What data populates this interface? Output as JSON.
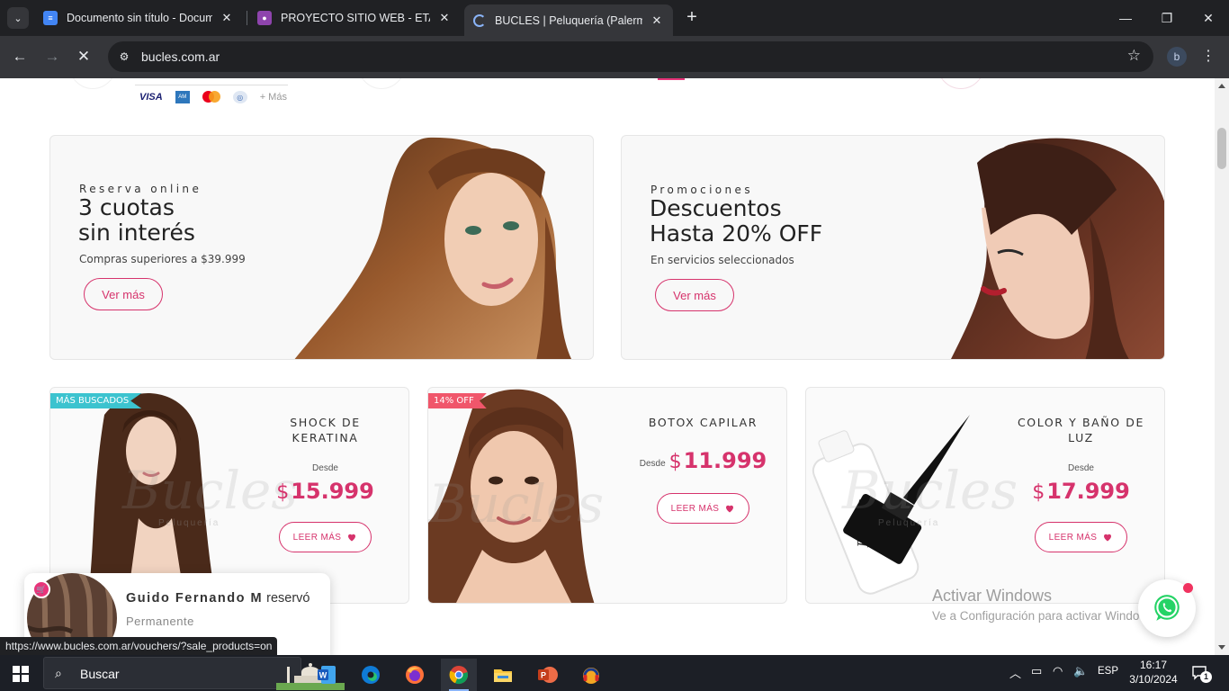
{
  "browser": {
    "tabs": [
      {
        "title": "Documento sin título - Documentos de Google",
        "close": "✕"
      },
      {
        "title": "PROYECTO SITIO WEB - ETAPAS",
        "close": "✕"
      },
      {
        "title": "BUCLES | Peluquería (Palermo Soho)",
        "close": "✕"
      }
    ],
    "new_tab": "+",
    "url": "bucles.com.ar",
    "window_controls": {
      "minimize": "—",
      "maximize": "❐",
      "close": "✕"
    },
    "profile_initial": "b"
  },
  "payments": {
    "visa": "VISA",
    "more": "+ Más"
  },
  "promos": [
    {
      "kicker": "Reserva online",
      "heading_line1": "3 cuotas",
      "heading_line2": "sin interés",
      "sub": "Compras superiores a $39.999",
      "cta": "Ver más"
    },
    {
      "kicker": "Promociones",
      "heading_line1": "Descuentos",
      "heading_line2": "Hasta 20% OFF",
      "sub": "En servicios seleccionados",
      "cta": "Ver más"
    }
  ],
  "services": [
    {
      "ribbon": "MÁS BUSCADOS",
      "name": "SHOCK DE KERATINA",
      "desde": "Desde",
      "currency": "$",
      "price": "15.999",
      "cta": "LEER MÁS"
    },
    {
      "ribbon": "14% OFF",
      "name": "BOTOX CAPILAR",
      "desde": "Desde",
      "currency": "$",
      "price": "11.999",
      "cta": "LEER MÁS"
    },
    {
      "ribbon": "",
      "name": "COLOR Y BAÑO DE LUZ",
      "desde": "Desde",
      "currency": "$",
      "price": "17.999",
      "cta": "LEER MÁS"
    }
  ],
  "watermark": {
    "word": "Bucles",
    "sub": "Peluquería"
  },
  "toast": {
    "name": "Guido Fernando M",
    "action": "reservó",
    "item": "Permanente"
  },
  "windows_activation": {
    "title": "Activar Windows",
    "sub": "Ve a Configuración para activar Windows."
  },
  "status_url": "https://www.bucles.com.ar/vouchers/?sale_products=on",
  "taskbar": {
    "search_placeholder": "Buscar",
    "language": "ESP",
    "time": "16:17",
    "date": "3/10/2024",
    "notifications": "1"
  },
  "colors": {
    "accent_pink": "#d6336c",
    "ribbon_teal": "#3cc3cf",
    "ribbon_red": "#f0566b",
    "whatsapp": "#25d366"
  }
}
